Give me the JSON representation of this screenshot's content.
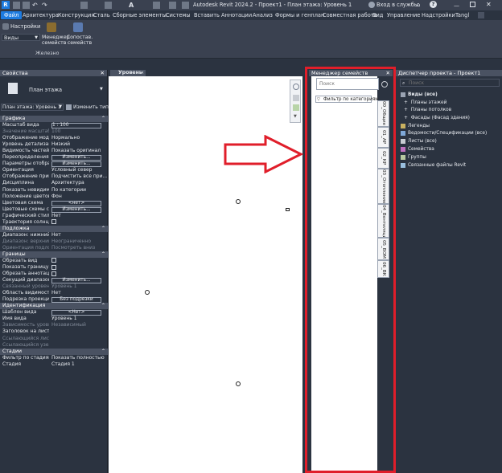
{
  "titlebar": {
    "title": "Autodesk Revit 2024.2 - Проект1 - План этажа: Уровень 1",
    "signin": "Вход в службы"
  },
  "ribbon_tabs": [
    "Файл",
    "Архитектура",
    "Конструкция",
    "Сталь",
    "Сборные элементы",
    "Системы",
    "Вставить",
    "Аннотации",
    "Анализ",
    "Формы и генплан",
    "Совместная работа",
    "Вид",
    "Управление",
    "Надстройки",
    "Tangl"
  ],
  "ribbon": {
    "settings_label": "Настройки",
    "views_label": "Виды",
    "family_manager_label": "Менеджер семейств",
    "compare_families_label": "Сопостав. семейств",
    "group_label": "Железно"
  },
  "properties": {
    "title": "Свойства",
    "type_name": "План этажа",
    "instance_selector": "План этажа: Уровень 1",
    "edit_type": "Изменить тип",
    "sections": [
      {
        "name": "Графика",
        "rows": [
          {
            "k": "Масштаб вида",
            "v": "1 : 100",
            "kind": "box"
          },
          {
            "k": "Значение масштаб...",
            "v": "100",
            "dim": true
          },
          {
            "k": "Отображение моде...",
            "v": "Нормально"
          },
          {
            "k": "Уровень детализации",
            "v": "Низкий"
          },
          {
            "k": "Видимость частей",
            "v": "Показать оригинал"
          },
          {
            "k": "Переопределения в...",
            "v": "Изменить...",
            "kind": "btn"
          },
          {
            "k": "Параметры отобра...",
            "v": "Изменить...",
            "kind": "btn"
          },
          {
            "k": "Ориентация",
            "v": "Условный север"
          },
          {
            "k": "Отображение прим...",
            "v": "Подчистить все при..."
          },
          {
            "k": "Дисциплина",
            "v": "Архитектура"
          },
          {
            "k": "Показать невидимы...",
            "v": "По категории"
          },
          {
            "k": "Положение цветов...",
            "v": "Фон"
          },
          {
            "k": "Цветовая схема",
            "v": "<нет>",
            "kind": "btn"
          },
          {
            "k": "Цветовые схемы си...",
            "v": "Изменить...",
            "kind": "btn"
          },
          {
            "k": "Графический стиль...",
            "v": "Нет"
          },
          {
            "k": "Траектория солнца",
            "v": "",
            "kind": "chk"
          }
        ]
      },
      {
        "name": "Подложка",
        "rows": [
          {
            "k": "Диапазон: нижний ...",
            "v": "Нет"
          },
          {
            "k": "Диапазон: верхний ...",
            "v": "Неограниченно",
            "dim": true
          },
          {
            "k": "Ориентация подло...",
            "v": "Посмотреть вниз",
            "dim": true
          }
        ]
      },
      {
        "name": "Границы",
        "rows": [
          {
            "k": "Обрезать вид",
            "v": "",
            "kind": "chk"
          },
          {
            "k": "Показать границу о...",
            "v": "",
            "kind": "chk"
          },
          {
            "k": "Обрезать аннотации",
            "v": "",
            "kind": "chk"
          },
          {
            "k": "Секущий диапазон",
            "v": "Изменить...",
            "kind": "btn"
          },
          {
            "k": "Связанный уровень",
            "v": "Уровень 1",
            "dim": true
          },
          {
            "k": "Область видимости",
            "v": "Нет"
          },
          {
            "k": "Подрезка проекции",
            "v": "Без подрезки",
            "kind": "btn"
          }
        ]
      },
      {
        "name": "Идентификация",
        "rows": [
          {
            "k": "Шаблон вида",
            "v": "<Нет>",
            "kind": "btn"
          },
          {
            "k": "Имя вида",
            "v": "Уровень 1"
          },
          {
            "k": "Зависимость уровня",
            "v": "Независимый",
            "dim": true
          },
          {
            "k": "Заголовок на листе",
            "v": ""
          },
          {
            "k": "Ссылающийся лист",
            "v": "",
            "dim": true
          },
          {
            "k": "Ссылающийся узел",
            "v": "",
            "dim": true
          }
        ]
      },
      {
        "name": "Стадии",
        "rows": [
          {
            "k": "Фильтр по стадиям",
            "v": "Показать полностью"
          },
          {
            "k": "Стадия",
            "v": "Стадия 1"
          }
        ]
      }
    ]
  },
  "view_tab": "Уровень 1",
  "family_manager": {
    "title": "Менеджер семейств",
    "search_placeholder": "Поиск",
    "filter_label": "Фильтр по категориям",
    "vertical_tabs": [
      "00_Общие",
      "01_АР",
      "02_КР",
      "03_Отопление",
      "04_Вентиляция",
      "05_ВОМ",
      "06_ВК"
    ]
  },
  "project_browser": {
    "title": "Диспетчер проекта - Проект1",
    "search_placeholder": "Поиск",
    "items": [
      {
        "label": "Виды (все)",
        "indent": 0,
        "bold": true
      },
      {
        "label": "Планы этажей",
        "indent": 1
      },
      {
        "label": "Планы потолков",
        "indent": 1
      },
      {
        "label": "Фасады (Фасад здания)",
        "indent": 1
      },
      {
        "label": "Легенды",
        "indent": 0
      },
      {
        "label": "Ведомости/Спецификации (все)",
        "indent": 0
      },
      {
        "label": "Листы (все)",
        "indent": 0
      },
      {
        "label": "Семейства",
        "indent": 0
      },
      {
        "label": "Группы",
        "indent": 0
      },
      {
        "label": "Связанные файлы Revit",
        "indent": 0
      }
    ]
  },
  "colors": {
    "accent_blue": "#1d7be0",
    "highlight_red": "#e01e2a",
    "panel_dark": "#2b3340"
  }
}
